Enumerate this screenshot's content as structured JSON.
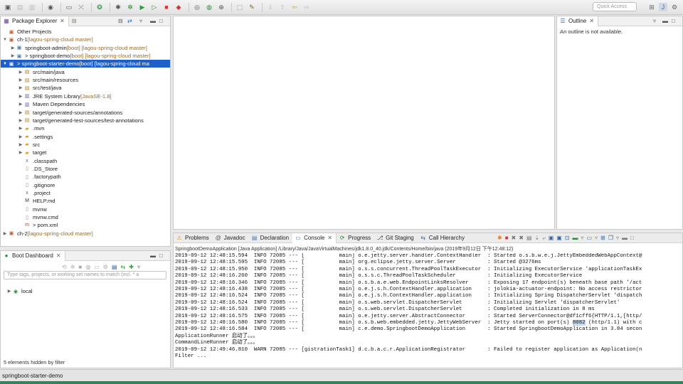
{
  "toolbar": {
    "quick_access_placeholder": "Quick Access"
  },
  "package_explorer": {
    "tab_label": "Package Explorer",
    "tab2_icon": "type-hierarchy-icon",
    "items": [
      {
        "label": "Other Projects",
        "suffix": ""
      },
      {
        "label": "ch-1",
        "suffix": " [lagou-spring-cloud master]"
      },
      {
        "label": "springboot-admin",
        "suffix": " [boot] [lagou-spring-cloud master]"
      },
      {
        "label": "> springboot-demo",
        "suffix": " [boot] [lagou-spring-cloud master]"
      },
      {
        "label": "> springboot-starter-demo",
        "suffix": " [boot] [lagou-spring-cloud ma"
      },
      {
        "label": "src/main/java",
        "suffix": ""
      },
      {
        "label": "src/main/resources",
        "suffix": ""
      },
      {
        "label": "src/test/java",
        "suffix": ""
      },
      {
        "label": "JRE System Library",
        "suffix": " [JavaSE-1.8]"
      },
      {
        "label": "Maven Dependencies",
        "suffix": ""
      },
      {
        "label": "target/generated-sources/annotations",
        "suffix": ""
      },
      {
        "label": "target/generated-test-sources/test-annotations",
        "suffix": ""
      },
      {
        "label": ".mvn",
        "suffix": ""
      },
      {
        "label": ".settings",
        "suffix": ""
      },
      {
        "label": "src",
        "suffix": ""
      },
      {
        "label": "target",
        "suffix": ""
      },
      {
        "label": ".classpath",
        "suffix": ""
      },
      {
        "label": ".DS_Store",
        "suffix": ""
      },
      {
        "label": ".factorypath",
        "suffix": ""
      },
      {
        "label": ".gitignore",
        "suffix": ""
      },
      {
        "label": ".project",
        "suffix": ""
      },
      {
        "label": "HELP.md",
        "suffix": ""
      },
      {
        "label": "mvnw",
        "suffix": ""
      },
      {
        "label": "mvnw.cmd",
        "suffix": ""
      },
      {
        "label": "> pom.xml",
        "suffix": ""
      },
      {
        "label": "ch-2",
        "suffix": " [lagou-spring-cloud master]"
      }
    ]
  },
  "outline": {
    "tab_label": "Outline",
    "message": "An outline is not available."
  },
  "boot_dashboard": {
    "tab_label": "Boot Dashboard",
    "search_placeholder": "Type tags, projects, or working set names to match (incl. * a",
    "local_label": "local",
    "hidden_note": "5 elements hidden by filter"
  },
  "console": {
    "tabs": [
      {
        "label": "Problems"
      },
      {
        "label": "Javadoc"
      },
      {
        "label": "Declaration"
      },
      {
        "label": "Console"
      },
      {
        "label": "Progress"
      },
      {
        "label": "Git Staging"
      },
      {
        "label": "Call Hierarchy"
      }
    ],
    "path": "SpringbootDemoApplication [Java Application] /Library/Java/JavaVirtualMachines/jdk1.8.0_40.jdk/Contents/Home/bin/java (2019年9月12日 下午12:48:12)",
    "lines": [
      "2019-09-12 12:48:15.594  INFO 72085 --- [           main] o.e.jetty.server.handler.ContextHandler  : Started o.s.b.w.e.j.JettyEmbeddedWebAppContext@",
      "2019-09-12 12:48:15.595  INFO 72085 --- [           main] org.eclipse.jetty.server.Server          : Started @3276ms",
      "2019-09-12 12:48:15.950  INFO 72085 --- [           main] o.s.s.concurrent.ThreadPoolTaskExecutor  : Initializing ExecutorService 'applicationTaskEx",
      "2019-09-12 12:48:16.260  INFO 72085 --- [           main] o.s.s.c.ThreadPoolTaskScheduler          : Initializing ExecutorService",
      "2019-09-12 12:48:16.346  INFO 72085 --- [           main] o.s.b.a.e.web.EndpointLinksResolver      : Exposing 17 endpoint(s) beneath base path '/act",
      "2019-09-12 12:48:16.438  INFO 72085 --- [           main] o.e.j.s.h.ContextHandler.application     : jolokia-actuator-endpoint: No access restrictor",
      "2019-09-12 12:48:16.524  INFO 72085 --- [           main] o.e.j.s.h.ContextHandler.application     : Initializing Spring DispatcherServlet 'dispatch",
      "2019-09-12 12:48:16.524  INFO 72085 --- [           main] o.s.web.servlet.DispatcherServlet        : Initializing Servlet 'dispatcherServlet'",
      "2019-09-12 12:48:16.533  INFO 72085 --- [           main] o.s.web.servlet.DispatcherServlet        : Completed initialization in 8 ms",
      "2019-09-12 12:48:16.575  INFO 72085 --- [           main] o.e.jetty.server.AbstractConnector       : Started ServerConnector@df1cff6{HTTP/1.1,[http/",
      "2019-09-12 12:48:16.580  INFO 72085 --- [           main] o.s.b.web.embedded.jetty.JettyWebServer  : Jetty started on port(s) 8082 (http/1.1) with c",
      "2019-09-12 12:48:16.584  INFO 72085 --- [           main] c.e.demo.SpringbootDemoApplication       : Started SpringbootDemoApplication in 3.84 secon",
      "ApplicationRunner 启动了。。。",
      "CommandLineRunner 启动了。。。",
      "2019-09-12 12:49:46.810  WARN 72085 --- [gistrationTask1] d.c.b.a.c.r.ApplicationRegistrator       : Failed to register application as Application(n",
      "Filter ..."
    ]
  },
  "status": {
    "selected": "springboot-starter-demo"
  }
}
